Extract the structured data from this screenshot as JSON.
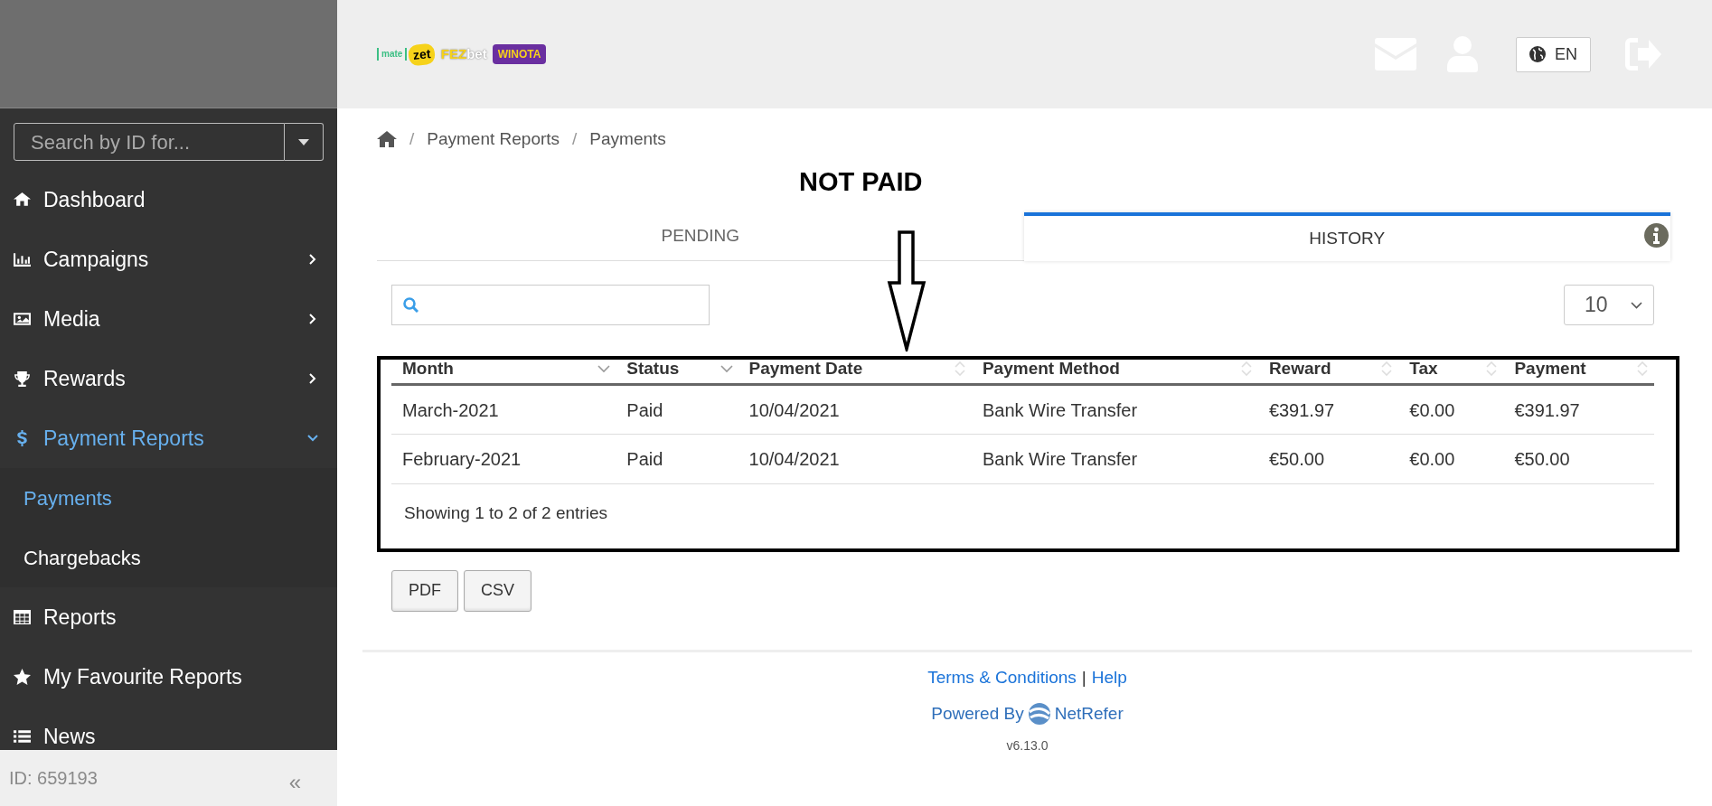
{
  "header": {
    "logos": [
      {
        "kind": "bracket",
        "text": "mate"
      },
      {
        "kind": "blob",
        "text": "zet"
      },
      {
        "kind": "split",
        "text": "FEZ",
        "text2": "bet"
      },
      {
        "kind": "banner",
        "text": "WINOTA"
      }
    ],
    "language": "EN"
  },
  "sidebar": {
    "search": {
      "placeholder": "Search by ID for..."
    },
    "items": [
      {
        "kind": "home",
        "label": "Dashboard",
        "selected": false
      },
      {
        "kind": "chart",
        "label": "Campaigns",
        "expanded": false,
        "selected": false
      },
      {
        "kind": "image",
        "label": "Media",
        "expanded": false,
        "selected": false
      },
      {
        "kind": "trophy",
        "label": "Rewards",
        "expanded": false,
        "selected": false
      },
      {
        "kind": "dollar",
        "label": "Payment Reports",
        "expanded": true,
        "selected": true,
        "children": [
          {
            "label": "Payments",
            "selected": true
          },
          {
            "label": "Chargebacks",
            "selected": false
          }
        ]
      },
      {
        "kind": "table",
        "label": "Reports",
        "selected": false
      },
      {
        "kind": "star",
        "label": "My Favourite Reports",
        "selected": false
      },
      {
        "kind": "list",
        "label": "News",
        "selected": false
      }
    ],
    "user_id": "ID: 659193",
    "collapse": "«"
  },
  "breadcrumb": [
    {
      "separator": "/",
      "label": "Payment Reports"
    },
    {
      "separator": "/",
      "label": "Payments"
    }
  ],
  "annotation": {
    "label": "NOT PAID"
  },
  "tabs": [
    {
      "label": "PENDING",
      "selected": false
    },
    {
      "label": "HISTORY",
      "selected": true
    }
  ],
  "page_size": "10",
  "table": {
    "columns": [
      {
        "label": "Month",
        "sorted": true
      },
      {
        "label": "Status",
        "sorted": true
      },
      {
        "label": "Payment Date",
        "sorted": false
      },
      {
        "label": "Payment Method",
        "sorted": false
      },
      {
        "label": "Reward",
        "sorted": false
      },
      {
        "label": "Tax",
        "sorted": false
      },
      {
        "label": "Payment",
        "sorted": false
      }
    ],
    "rows": [
      [
        "March-2021",
        "Paid",
        "10/04/2021",
        "Bank Wire Transfer",
        "€391.97",
        "€0.00",
        "€391.97"
      ],
      [
        "February-2021",
        "Paid",
        "10/04/2021",
        "Bank Wire Transfer",
        "€50.00",
        "€0.00",
        "€50.00"
      ]
    ],
    "info": "Showing 1 to 2 of 2 entries"
  },
  "export_buttons": [
    "PDF",
    "CSV"
  ],
  "footer": {
    "links": [
      "Terms & Conditions",
      "Help"
    ],
    "separator": "|",
    "powered_by": "Powered By",
    "brand": "NetRefer",
    "version": "v6.13.0"
  }
}
